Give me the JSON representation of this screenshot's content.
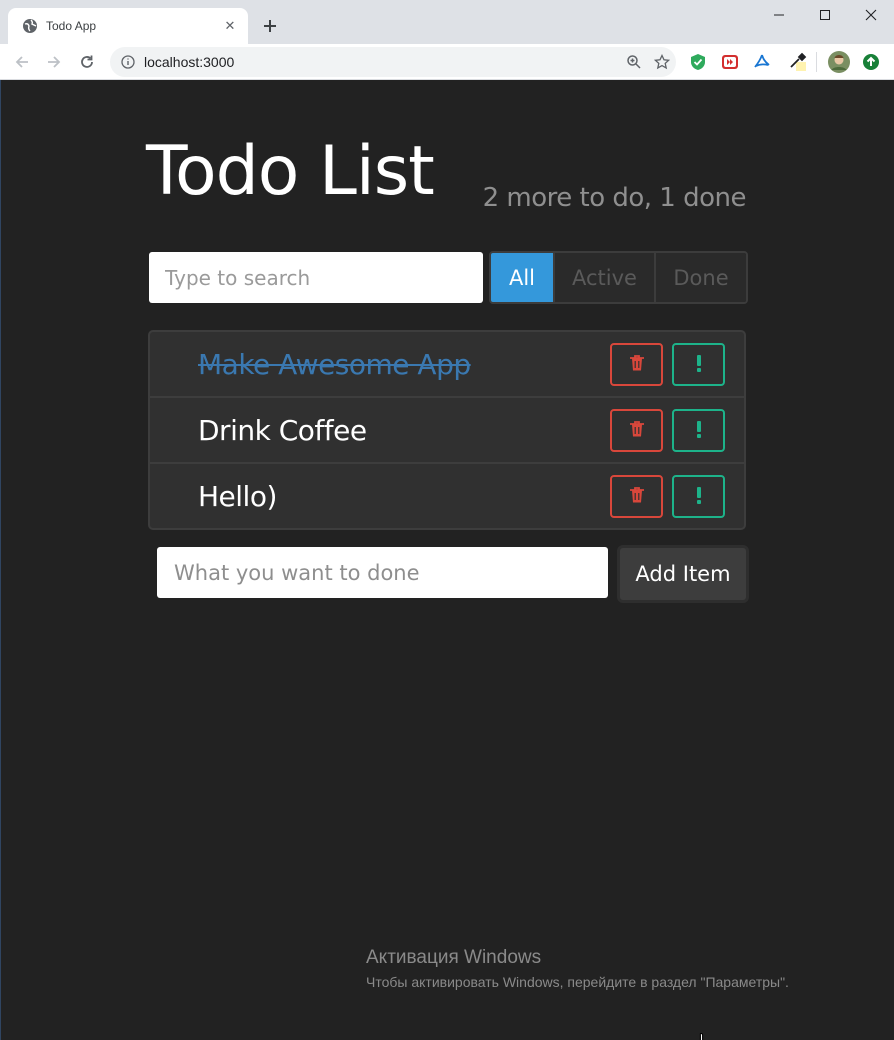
{
  "browser": {
    "tab_title": "Todo App",
    "url": "localhost:3000"
  },
  "app": {
    "title": "Todo List",
    "stats": "2 more to do, 1 done",
    "search_placeholder": "Type to search",
    "filters": [
      {
        "label": "All",
        "active": true
      },
      {
        "label": "Active",
        "active": false
      },
      {
        "label": "Done",
        "active": false
      }
    ],
    "items": [
      {
        "label": "Make Awesome App",
        "done": true
      },
      {
        "label": "Drink Coffee",
        "done": false
      },
      {
        "label": "Hello)",
        "done": false
      }
    ],
    "add_placeholder": "What you want to done",
    "add_button_label": "Add Item"
  },
  "watermark": {
    "title": "Активация Windows",
    "subtitle": "Чтобы активировать Windows, перейдите в раздел \"Параметры\"."
  },
  "colors": {
    "background": "#222222",
    "accent": "#3498db",
    "delete": "#d9473b",
    "important": "#1db38a",
    "done_text": "#3a78b0"
  },
  "icons": {
    "delete": "trash-icon",
    "important": "exclamation-icon"
  }
}
